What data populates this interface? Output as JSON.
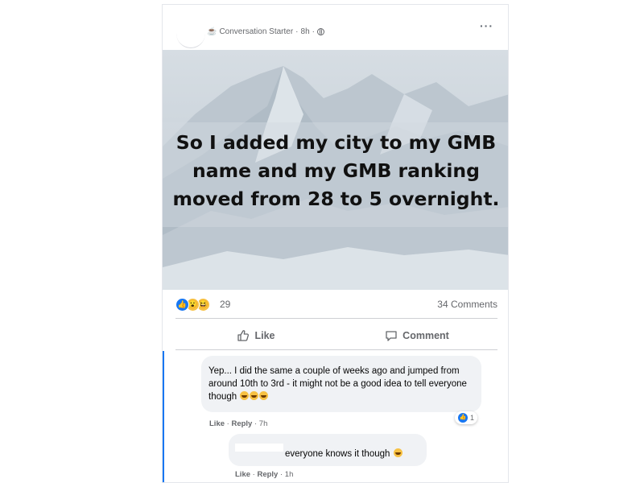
{
  "post": {
    "group_badge": "Conversation Starter",
    "separator": "·",
    "time": "8h",
    "more": "···",
    "hero_text": "So I added my city to my GMB name and my GMB ranking moved from 28 to 5 overnight."
  },
  "stats": {
    "reaction_count": "29",
    "comments_count": "34 Comments"
  },
  "actions": {
    "like": "Like",
    "comment": "Comment"
  },
  "comments": [
    {
      "text": "Yep... I did the same a couple of weeks ago and jumped from around 10th to 3rd - it might not be a good idea to tell everyone though",
      "like": "Like",
      "reply": "Reply",
      "time": "7h",
      "reactions": "1"
    },
    {
      "text": "everyone knows it though",
      "like": "Like",
      "reply": "Reply",
      "time": "1h"
    }
  ],
  "colors": {
    "accent": "#1877f2",
    "muted": "#65676b",
    "bubble": "#f0f2f5"
  }
}
